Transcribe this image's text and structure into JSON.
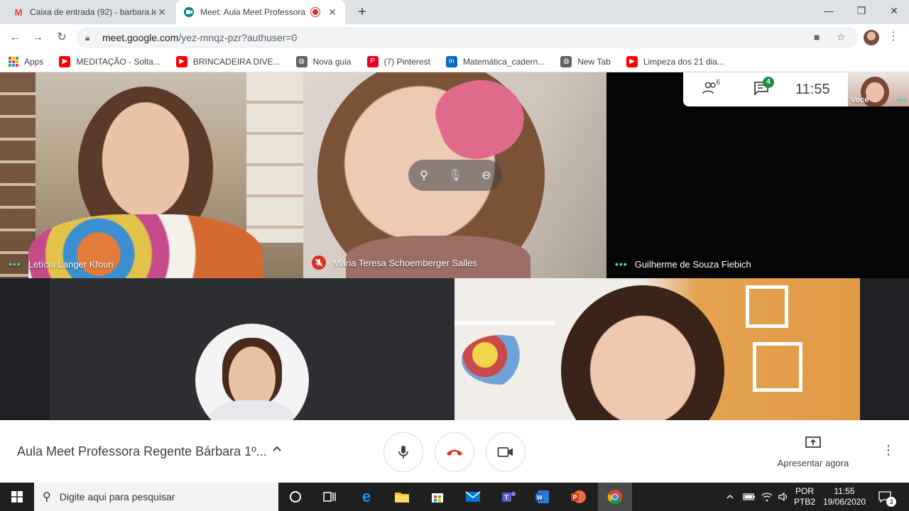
{
  "tabs": [
    {
      "title": "Caixa de entrada (92) - barbara.le",
      "favicon": "gmail-icon"
    },
    {
      "title": "Meet: Aula Meet Professora",
      "favicon": "meet-icon",
      "recording": true
    }
  ],
  "address": {
    "domain": "meet.google.com",
    "path": "/yez-mnqz-pzr?authuser=0"
  },
  "bookmarks": [
    {
      "label": "Apps",
      "icon": "apps-grid-icon"
    },
    {
      "label": "MEDITAÇÃO - Solta...",
      "icon": "youtube-icon"
    },
    {
      "label": "BRINCADEIRA DIVE...",
      "icon": "youtube-icon"
    },
    {
      "label": "Nova guia",
      "icon": "globe-icon"
    },
    {
      "label": "(7) Pinterest",
      "icon": "pinterest-icon"
    },
    {
      "label": "Matemática_cadern...",
      "icon": "linkedin-icon"
    },
    {
      "label": "New Tab",
      "icon": "globe-icon"
    },
    {
      "label": "Limpeza dos 21 dia...",
      "icon": "youtube-icon"
    }
  ],
  "participants": [
    {
      "name": "Letícia Langer Kfouri",
      "muted": false
    },
    {
      "name": "Maria Teresa Schoemberger Salles",
      "muted": true
    },
    {
      "name": "Guilherme de Souza Fiebich",
      "muted": false
    }
  ],
  "info_panel": {
    "people_count": "6",
    "chat_badge": "4",
    "clock": "11:55",
    "self_label": "Você"
  },
  "bottom": {
    "meeting_title": "Aula Meet Professora Regente Bárbara 1º...",
    "present_label": "Apresentar agora"
  },
  "taskbar": {
    "search_placeholder": "Digite aqui para pesquisar",
    "lang": "POR",
    "layout": "PTB2",
    "time": "11:55",
    "date": "19/06/2020",
    "notif_count": "3"
  },
  "colors": {
    "meet_green": "#00897b",
    "hangup_red": "#d93025",
    "active_dot": "#4fd1b5",
    "chat_badge": "#1e8e3e"
  }
}
